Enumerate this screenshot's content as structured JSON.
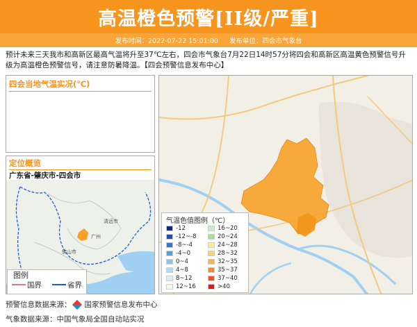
{
  "banner": {
    "title": "高温橙色预警[II级/严重]"
  },
  "meta": {
    "publish_time": "发布时间：2022-07-22 15:01:00",
    "publisher": "发布单位：四会市气象台"
  },
  "notice": "预计未来三天我市和高新区最高气温将升至37℃左右，四会市气象台7月22日14时57分将四会和高新区高温黄色预警信号升级为高温橙色预警信号，请注意防暑降温。【四会预警信息发布中心】",
  "temp_panel": {
    "title": "四会当地气温实况(℃)"
  },
  "location_panel": {
    "title": "定位概览",
    "path": "广东省-肇庆市-四会市",
    "map_labels": [
      "清远市",
      "佛山市",
      "广州"
    ],
    "legend_title": "图例",
    "legend_items": [
      {
        "label": "国界",
        "color": "#d77a8a"
      },
      {
        "label": "省界",
        "color": "#1e5bd8"
      }
    ]
  },
  "color_legend": {
    "title": "气温色值图例（℃）",
    "left": [
      {
        "label": "-12",
        "color": "#0b2d7a"
      },
      {
        "label": "-12~-8",
        "color": "#1f4fa6"
      },
      {
        "label": "-8~-4",
        "color": "#3974c8"
      },
      {
        "label": "-4~0",
        "color": "#5e9ad6"
      },
      {
        "label": "0~4",
        "color": "#8cc1e8"
      },
      {
        "label": "4~8",
        "color": "#b3dcf2"
      },
      {
        "label": "8~12",
        "color": "#d8eff8"
      },
      {
        "label": "12~16",
        "color": "#f4fbea"
      }
    ],
    "right": [
      {
        "label": "16~20",
        "color": "#cdeccd"
      },
      {
        "label": "20~24",
        "color": "#a8dc94"
      },
      {
        "label": "24~28",
        "color": "#f5ef9b"
      },
      {
        "label": "28~32",
        "color": "#f8d479"
      },
      {
        "label": "32~35",
        "color": "#f6b35b"
      },
      {
        "label": "35~37",
        "color": "#f08a3c"
      },
      {
        "label": "37~40",
        "color": "#e5572b"
      },
      {
        "label": ">40",
        "color": "#cc1f1f"
      }
    ]
  },
  "footer": {
    "source1_label": "预警信息数据来源：",
    "source1_value": "国家预警信息发布中心",
    "source2": "气象数据来源：中国气象局全国自动站实况"
  },
  "colors": {
    "accent": "#f7941d",
    "region": "#f7a128",
    "water": "#9fd0f2"
  }
}
